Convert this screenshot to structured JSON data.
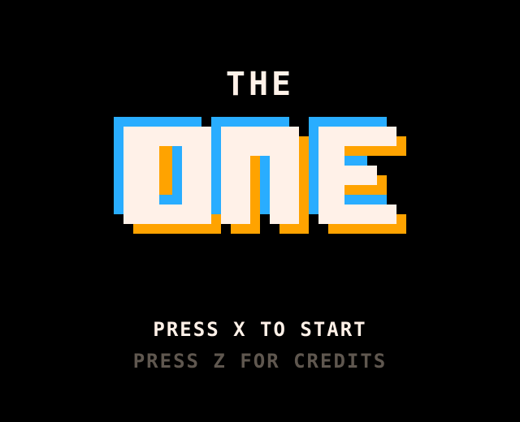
{
  "title": {
    "top_word": "THE",
    "main_word": "ONE"
  },
  "prompts": {
    "start": "PRESS X TO START",
    "credits": "PRESS Z FOR CREDITS"
  },
  "colors": {
    "background": "#000000",
    "cream": "#FFF1E8",
    "blue": "#29ADFF",
    "orange": "#FFA300",
    "gray": "#5F574F"
  }
}
